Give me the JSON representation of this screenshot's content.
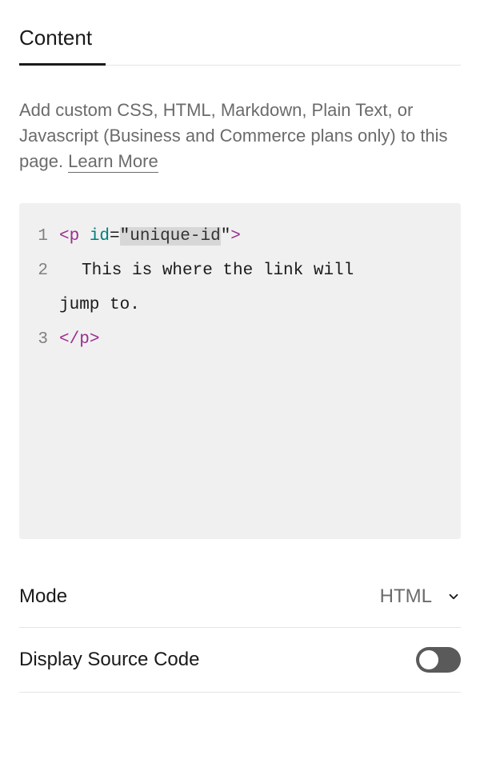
{
  "tabs": {
    "content": "Content"
  },
  "description": {
    "text": "Add custom CSS, HTML, Markdown, Plain Text, or Javascript (Business and Commerce plans only) to this page. ",
    "learn_more": "Learn More"
  },
  "code": {
    "lines": [
      {
        "num": "1"
      },
      {
        "num": "2"
      },
      {
        "num": "3"
      }
    ],
    "line1": {
      "open_bracket": "<",
      "tag": "p",
      "space": " ",
      "attr": "id",
      "eq": "=",
      "quote1": "\"",
      "value": "unique-id",
      "quote2": "\"",
      "close_bracket": ">"
    },
    "line2": {
      "text_part1": "This is where the link will",
      "text_part2": "jump to."
    },
    "line3": {
      "open_bracket": "</",
      "tag": "p",
      "close_bracket": ">"
    }
  },
  "settings": {
    "mode": {
      "label": "Mode",
      "value": "HTML"
    },
    "display_source": {
      "label": "Display Source Code",
      "enabled": false
    }
  }
}
